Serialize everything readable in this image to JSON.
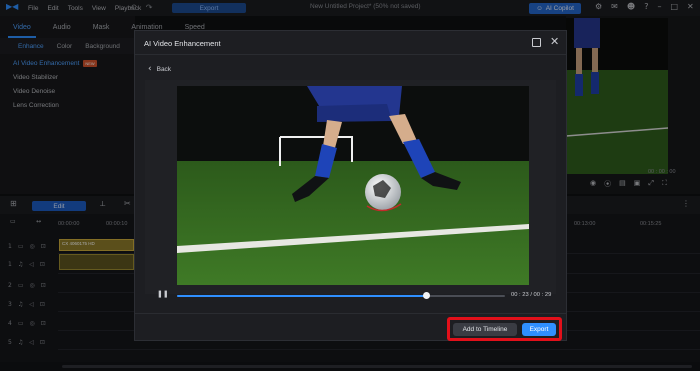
{
  "titlebar": {
    "menu": [
      "File",
      "Edit",
      "Tools",
      "View",
      "Playback"
    ],
    "export_label": "Export",
    "project_title": "New Untitled Project* (50% not saved)",
    "copilot_label": "AI Copilot"
  },
  "left_panel": {
    "tabs": [
      "Video",
      "Audio",
      "Mask",
      "Animation",
      "Speed"
    ],
    "subtabs": [
      "Enhance",
      "Color",
      "Background"
    ],
    "features": [
      {
        "label": "AI Video Enhancement",
        "badge": "NEW"
      },
      {
        "label": "Video Stabilizer"
      },
      {
        "label": "Video Denoise"
      },
      {
        "label": "Lens Correction"
      }
    ]
  },
  "preview": {
    "timecode": "00 : 00 : 00"
  },
  "timeline": {
    "edit_label": "Edit",
    "ruler": [
      "00:00:00",
      "00:00:10",
      "00:13:00",
      "00:15:25"
    ],
    "clip_name": "CX 4060175 HD",
    "tracks": [
      "1",
      "1",
      "2",
      "3",
      "4",
      "5"
    ]
  },
  "dialog": {
    "title": "AI Video Enhancement",
    "back_label": "Back",
    "progress": 0.76,
    "timecode": "00 : 23 / 00 : 29",
    "add_to_timeline_label": "Add to Timeline",
    "export_label": "Export"
  },
  "colors": {
    "accent": "#2f8fff",
    "highlight": "#e2101a"
  }
}
